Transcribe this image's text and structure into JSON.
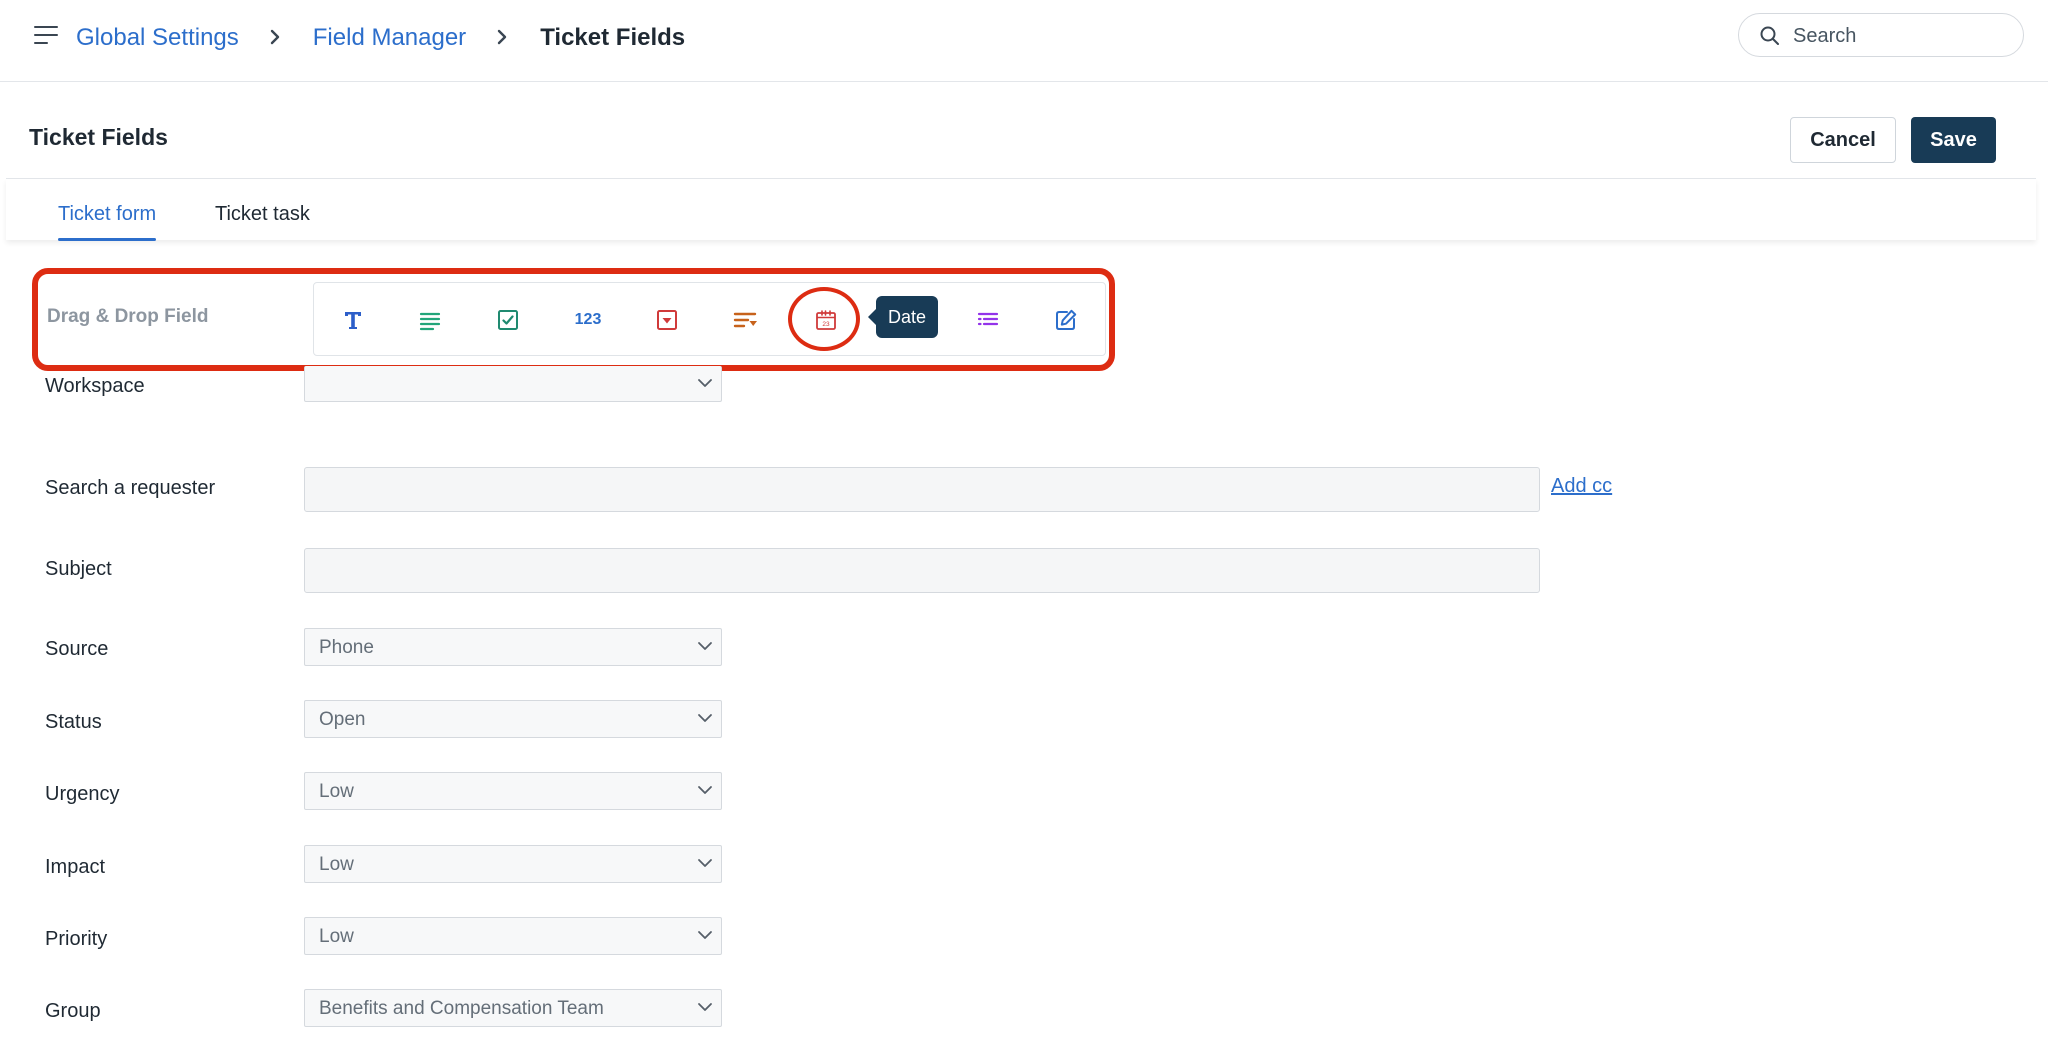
{
  "header": {
    "breadcrumbs": [
      "Global Settings",
      "Field Manager",
      "Ticket Fields"
    ],
    "search_placeholder": "Search"
  },
  "page": {
    "title": "Ticket Fields",
    "cancel_label": "Cancel",
    "save_label": "Save"
  },
  "tabs": [
    {
      "label": "Ticket form",
      "active": true
    },
    {
      "label": "Ticket task",
      "active": false
    }
  ],
  "drag_drop": {
    "label": "Drag & Drop Field",
    "tools": [
      {
        "icon": "text-icon"
      },
      {
        "icon": "paragraph-icon"
      },
      {
        "icon": "checkbox-icon"
      },
      {
        "icon": "number-icon",
        "text": "123"
      },
      {
        "icon": "dropdown-icon"
      },
      {
        "icon": "dependent-dropdown-icon"
      },
      {
        "icon": "calendar-icon"
      },
      {
        "icon": "multi-select-icon"
      },
      {
        "icon": "edit-icon"
      }
    ],
    "tooltip": "Date"
  },
  "form": {
    "workspace": {
      "label": "Workspace",
      "value": ""
    },
    "requester": {
      "label": "Search a requester",
      "value": "",
      "add_cc": "Add cc"
    },
    "subject": {
      "label": "Subject",
      "value": ""
    },
    "source": {
      "label": "Source",
      "value": "Phone"
    },
    "status": {
      "label": "Status",
      "value": "Open"
    },
    "urgency": {
      "label": "Urgency",
      "value": "Low"
    },
    "impact": {
      "label": "Impact",
      "value": "Low"
    },
    "priority": {
      "label": "Priority",
      "value": "Low"
    },
    "group": {
      "label": "Group",
      "value": "Benefits and Compensation Team"
    }
  },
  "colors": {
    "link": "#2c6ecb",
    "primary": "#183b56",
    "highlight": "#dd2c12"
  }
}
